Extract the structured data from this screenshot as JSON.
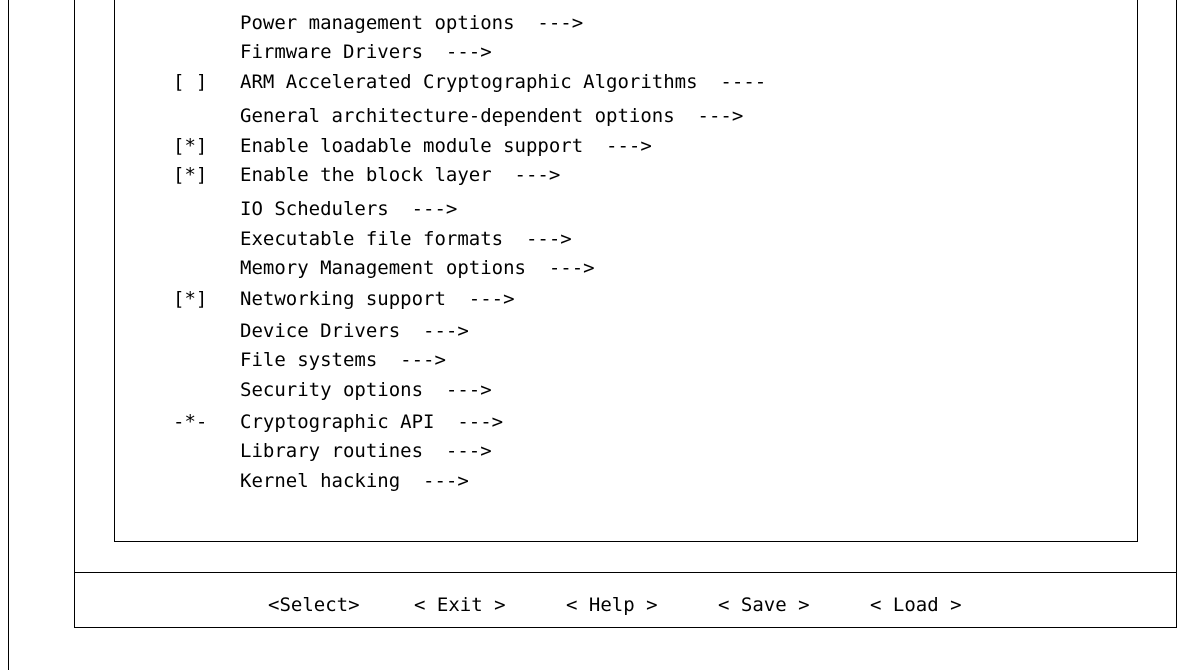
{
  "menu": {
    "items": [
      {
        "mark": "",
        "label": "Power management options  --->"
      },
      {
        "mark": "",
        "label": "Firmware Drivers  --->"
      },
      {
        "mark": "[ ]",
        "label": "ARM Accelerated Cryptographic Algorithms  ----"
      },
      {
        "mark": "",
        "label": "General architecture-dependent options  --->"
      },
      {
        "mark": "[*]",
        "label": "Enable loadable module support  --->"
      },
      {
        "mark": "[*]",
        "label": "Enable the block layer  --->"
      },
      {
        "mark": "",
        "label": "IO Schedulers  --->"
      },
      {
        "mark": "",
        "label": "Executable file formats  --->"
      },
      {
        "mark": "",
        "label": "Memory Management options  --->"
      },
      {
        "mark": "[*]",
        "label": "Networking support  --->"
      },
      {
        "mark": "",
        "label": "Device Drivers  --->"
      },
      {
        "mark": "",
        "label": "File systems  --->"
      },
      {
        "mark": "",
        "label": "Security options  --->"
      },
      {
        "mark": "-*-",
        "label": "Cryptographic API  --->"
      },
      {
        "mark": "",
        "label": "Library routines  --->"
      },
      {
        "mark": "",
        "label": "Kernel hacking  --->"
      }
    ]
  },
  "buttons": {
    "select": "<Select>",
    "exit": "< Exit >",
    "help": "< Help >",
    "save": "< Save >",
    "load": "< Load >"
  }
}
